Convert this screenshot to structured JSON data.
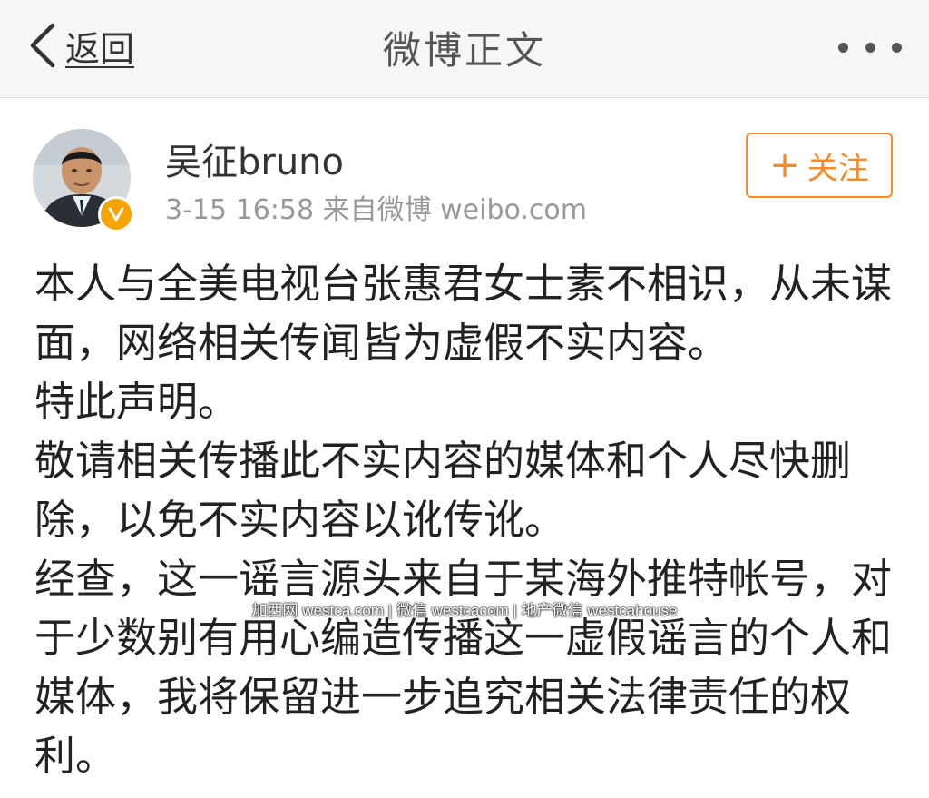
{
  "nav": {
    "back_label": "返回",
    "title": "微博正文"
  },
  "post": {
    "username": "吴征bruno",
    "meta": "3-15 16:58  来自微博 weibo.com",
    "follow_label": "关注",
    "paragraphs": [
      "本人与全美电视台张惠君女士素不相识，从未谋面，网络相关传闻皆为虚假不实内容。",
      "特此声明。",
      "敬请相关传播此不实内容的媒体和个人尽快删除，以免不实内容以讹传讹。",
      "经查，这一谣言源头来自于某海外推特帐号，对于少数别有用心编造传播这一虚假谣言的个人和媒体，我将保留进一步追究相关法律责任的权利。"
    ]
  },
  "watermark": "加西网 westca.com | 微信 westcacom | 地产微信 westcahouse",
  "icons": {
    "back": "chevron-left-icon",
    "more": "more-dots-icon",
    "verified": "verified-v-icon",
    "follow": "plus-icon"
  },
  "colors": {
    "accent": "#f28c2e",
    "verified": "#f7a300",
    "navbar_bg": "#f6f6f6",
    "meta_text": "#999999"
  }
}
